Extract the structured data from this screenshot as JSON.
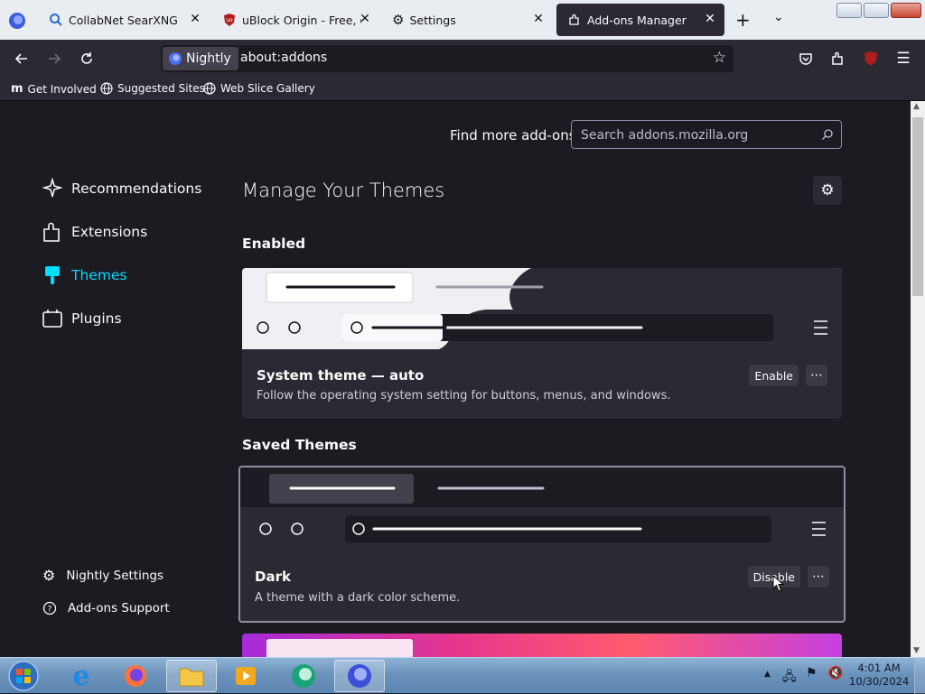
{
  "browser": {
    "tabs": [
      {
        "title": "CollabNet SearXNG",
        "icon": "search-icon"
      },
      {
        "title": "uBlock Origin - Free, open-source",
        "icon": "ublock-icon"
      },
      {
        "title": "Settings",
        "icon": "gear-icon"
      },
      {
        "title": "Add-ons Manager",
        "icon": "puzzle-icon",
        "active": true
      }
    ],
    "identity_label": "Nightly",
    "url": "about:addons",
    "bookmarks": [
      {
        "label": "Get Involved",
        "icon": "mozilla-icon"
      },
      {
        "label": "Suggested Sites",
        "icon": "globe-icon"
      },
      {
        "label": "Web Slice Gallery",
        "icon": "globe-icon"
      }
    ]
  },
  "addons": {
    "find_more_label": "Find more add-ons",
    "search_placeholder": "Search addons.mozilla.org",
    "categories": [
      {
        "label": "Recommendations",
        "icon": "sparkle-icon"
      },
      {
        "label": "Extensions",
        "icon": "puzzle-icon"
      },
      {
        "label": "Themes",
        "icon": "brush-icon",
        "selected": true
      },
      {
        "label": "Plugins",
        "icon": "plugin-icon"
      }
    ],
    "footer": [
      {
        "label": "Nightly Settings",
        "icon": "gear-icon"
      },
      {
        "label": "Add-ons Support",
        "icon": "help-icon"
      }
    ],
    "heading": "Manage Your Themes",
    "enabled_title": "Enabled",
    "saved_title": "Saved Themes",
    "themes": [
      {
        "name": "System theme — auto",
        "description": "Follow the operating system setting for buttons, menus, and windows.",
        "action": "Enable"
      },
      {
        "name": "Dark",
        "description": "A theme with a dark color scheme.",
        "action": "Disable"
      }
    ]
  },
  "taskbar": {
    "time": "4:01 AM",
    "date": "10/30/2024"
  },
  "colors": {
    "accent": "#00ddff",
    "background": "#1c1b22",
    "surface": "#2b2a33"
  }
}
